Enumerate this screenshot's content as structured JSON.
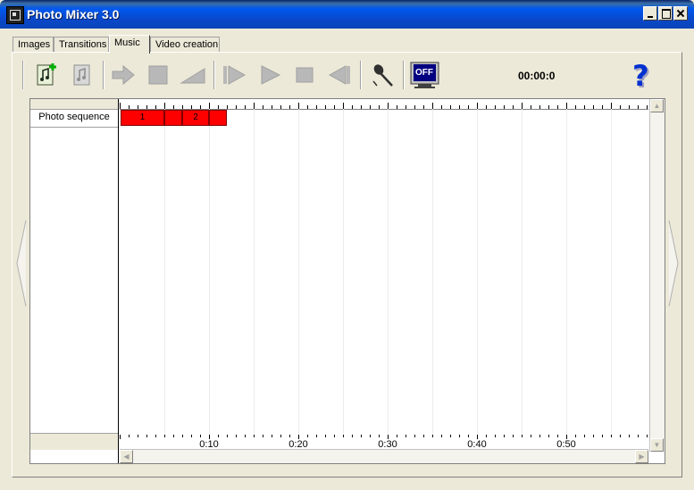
{
  "window": {
    "title": "Photo Mixer 3.0"
  },
  "tabs": [
    {
      "label": "Images",
      "active": false
    },
    {
      "label": "Transitions",
      "active": false
    },
    {
      "label": "Music",
      "active": true
    },
    {
      "label": "Video creation",
      "active": false
    }
  ],
  "toolbar": {
    "icons": [
      "add-music-icon",
      "remove-music-icon",
      "forward-arrow-icon",
      "stop-square-icon",
      "volume-ramp-icon",
      "play-from-start-icon",
      "play-icon",
      "stop-icon",
      "rewind-icon",
      "microphone-icon",
      "monitor-off-icon",
      "help-icon"
    ],
    "monitor_label": "OFF",
    "help_label": "?",
    "timecode": "00:00:0"
  },
  "timeline": {
    "track_label": "Photo sequence",
    "clips": [
      {
        "label": "1",
        "start": 0.1,
        "end": 5.0
      },
      {
        "label": "",
        "start": 5.0,
        "end": 7.0
      },
      {
        "label": "2",
        "start": 7.0,
        "end": 10.0
      },
      {
        "label": "",
        "start": 10.0,
        "end": 12.0
      }
    ],
    "ruler_labels": [
      "0:10",
      "0:20",
      "0:30",
      "0:40",
      "0:50"
    ],
    "clip_color": "#ff0000",
    "visible_seconds": 59
  },
  "colors": {
    "title_bar": "#0058ee",
    "window_bg": "#ece9d8",
    "timeline_bg": "#ffffff"
  }
}
